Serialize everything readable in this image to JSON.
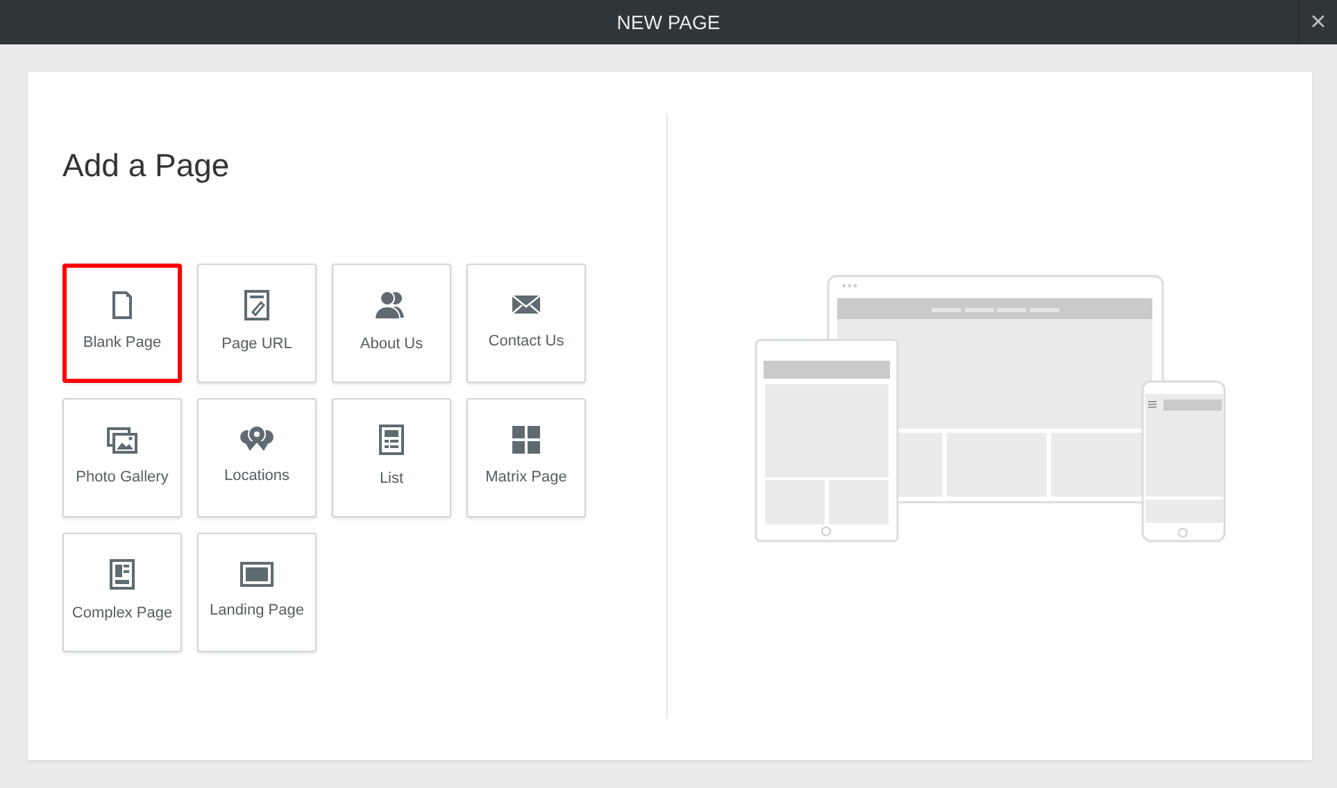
{
  "window": {
    "title": "NEW PAGE",
    "close": "×"
  },
  "heading": "Add a Page",
  "tiles": [
    {
      "label": "Blank Page",
      "kind": "blank",
      "selected": true
    },
    {
      "label": "Page URL",
      "kind": "url",
      "selected": false
    },
    {
      "label": "About Us",
      "kind": "people",
      "selected": false
    },
    {
      "label": "Contact Us",
      "kind": "mail",
      "selected": false
    },
    {
      "label": "Photo Gallery",
      "kind": "photos",
      "selected": false
    },
    {
      "label": "Locations",
      "kind": "pins",
      "selected": false
    },
    {
      "label": "List",
      "kind": "list",
      "selected": false
    },
    {
      "label": "Matrix Page",
      "kind": "grid",
      "selected": false
    },
    {
      "label": "Complex Page",
      "kind": "complex",
      "selected": false
    },
    {
      "label": "Landing Page",
      "kind": "landing",
      "selected": false
    }
  ]
}
